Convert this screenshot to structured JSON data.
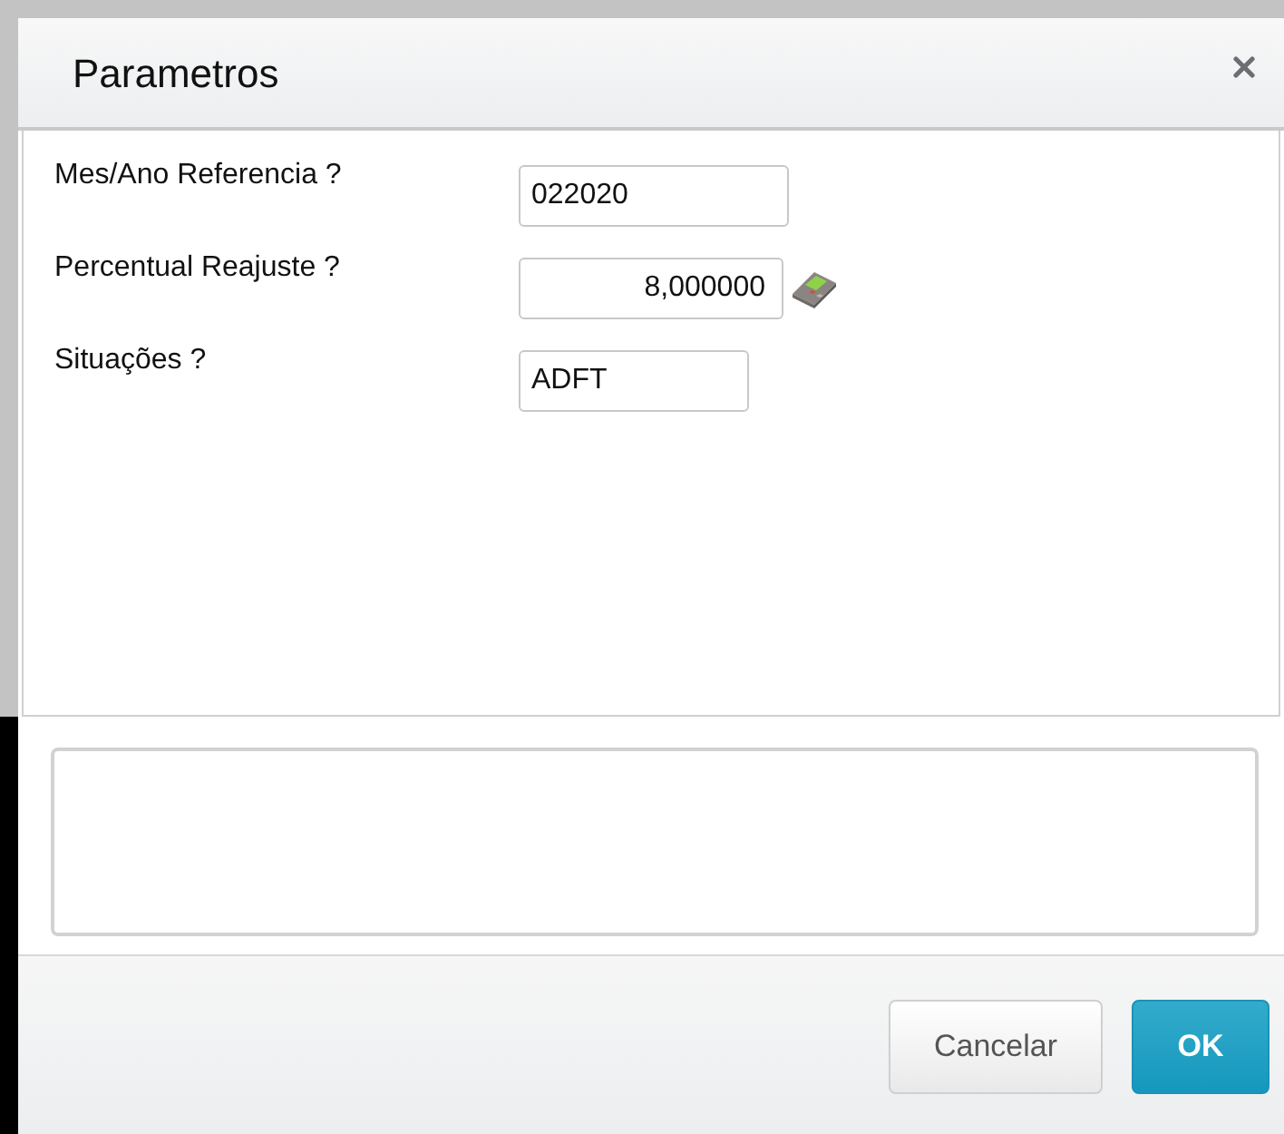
{
  "dialog": {
    "title": "Parametros"
  },
  "parameters": [
    {
      "label": "Mes/Ano Referencia ?",
      "value": "022020",
      "kind": "text"
    },
    {
      "label": "Percentual Reajuste ?",
      "value": "8,000000",
      "kind": "number"
    },
    {
      "label": "Situações ?",
      "value": "ADFT",
      "kind": "text"
    }
  ],
  "buttons": [
    {
      "label": "Cancelar",
      "kind": "secondary"
    },
    {
      "label": "OK",
      "kind": "primary"
    }
  ]
}
